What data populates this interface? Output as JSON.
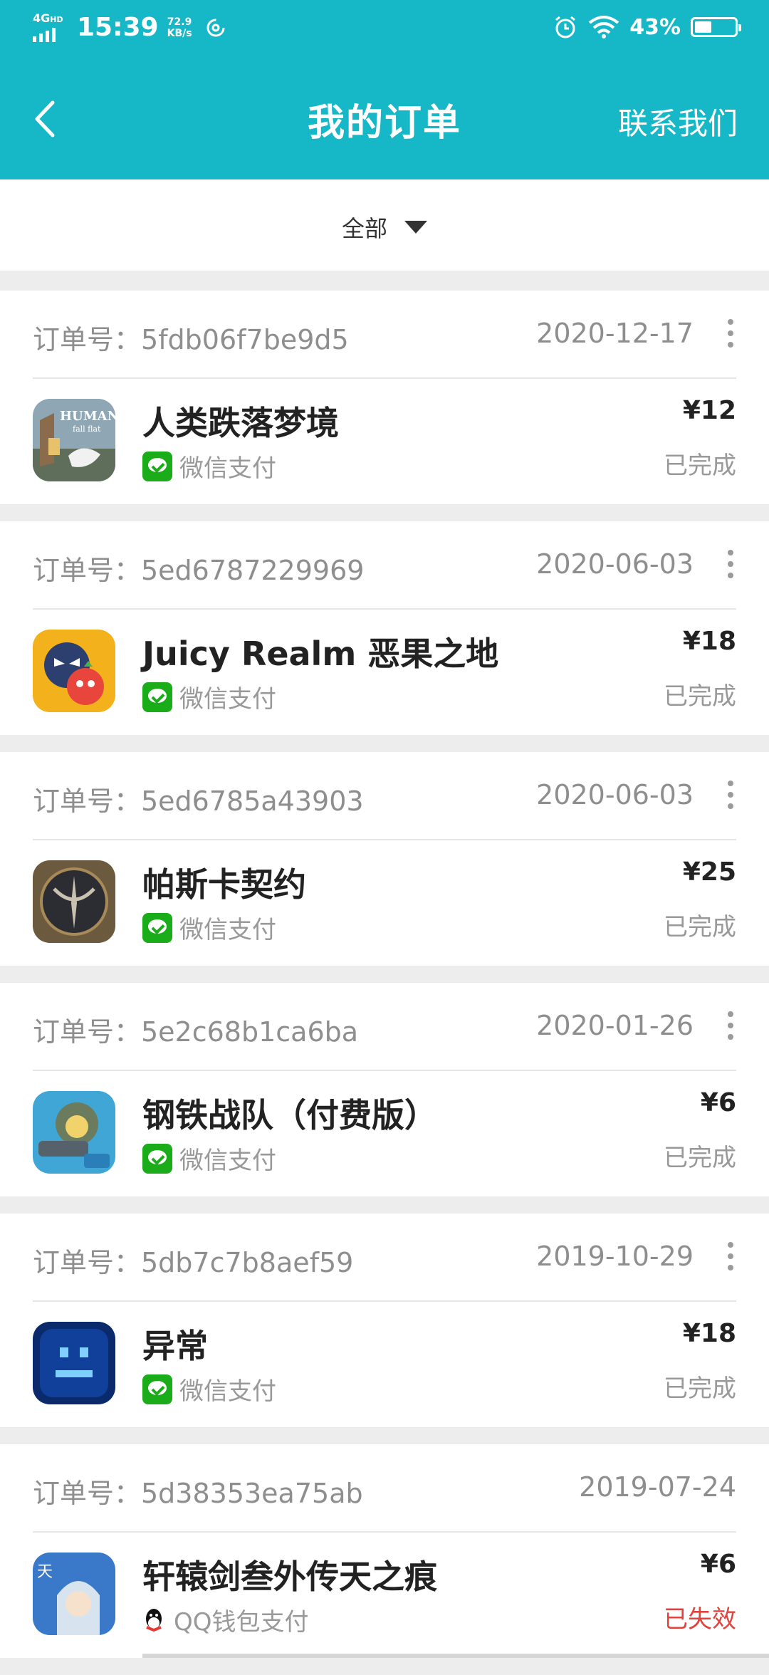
{
  "status_bar": {
    "network": "4G",
    "network_badge": "HD",
    "time": "15:39",
    "speed_value": "72.9",
    "speed_unit": "KB/s",
    "battery_pct": "43%",
    "battery_level": 0.43
  },
  "header": {
    "title": "我的订单",
    "contact_label": "联系我们",
    "bg_color": "#16b7c7"
  },
  "filter": {
    "label": "全部"
  },
  "orders": [
    {
      "order_no": "订单号：5fdb06f7be9d5",
      "date": "2020-12-17",
      "name": "人类跌落梦境",
      "payment": "微信支付",
      "price": "¥12",
      "status": "已完成",
      "icon": "human-fall-flat-icon"
    },
    {
      "order_no": "订单号：5ed6787229969",
      "date": "2020-06-03",
      "name": "Juicy Realm 恶果之地",
      "payment": "微信支付",
      "price": "¥18",
      "status": "已完成",
      "icon": "juicy-realm-icon"
    },
    {
      "order_no": "订单号：5ed6785a43903",
      "date": "2020-06-03",
      "name": "帕斯卡契约",
      "payment": "微信支付",
      "price": "¥25",
      "status": "已完成",
      "icon": "pascals-wager-icon"
    },
    {
      "order_no": "订单号：5e2c68b1ca6ba",
      "date": "2020-01-26",
      "name": "钢铁战队（付费版）",
      "payment": "微信支付",
      "price": "¥6",
      "status": "已完成",
      "icon": "iron-marines-icon"
    },
    {
      "order_no": "订单号：5db7c7b8aef59",
      "date": "2019-10-29",
      "name": "异常",
      "payment": "微信支付",
      "price": "¥18",
      "status": "已完成",
      "icon": "exception-icon"
    },
    {
      "order_no": "订单号：5d38353ea75ab",
      "date": "2019-07-24",
      "name": "轩辕剑叁外传天之痕",
      "payment": "QQ钱包支付",
      "price": "¥6",
      "status": "已失效",
      "icon": "xuanyuan-sword-icon"
    }
  ]
}
